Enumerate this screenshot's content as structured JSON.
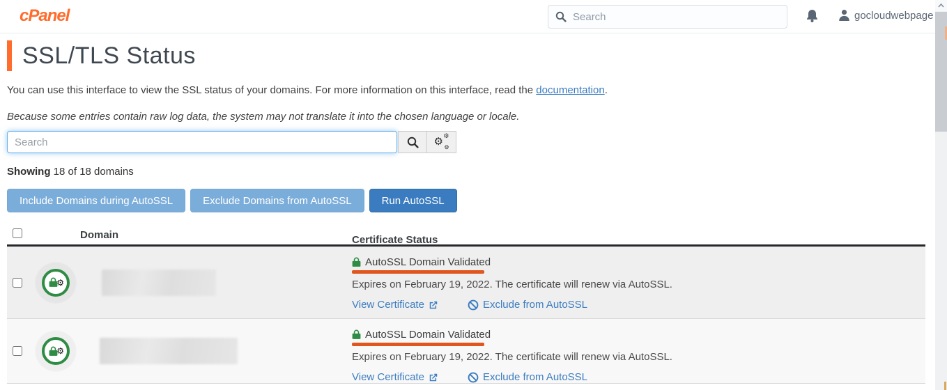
{
  "colors": {
    "brand-orange": "#ff6c2c",
    "link-blue": "#3a7cc0",
    "green": "#2f8c44",
    "annot-orange": "#e0561e",
    "btn-light": "#7badda",
    "btn-primary": "#3a7cbf"
  },
  "header": {
    "logo": "cPanel",
    "search_placeholder": "Search",
    "username": "gocloudwebpage"
  },
  "page": {
    "title": "SSL/TLS Status",
    "intro_before_link": "You can use this interface to view the SSL status of your domains. For more information on this interface, read the ",
    "intro_link": "documentation",
    "intro_after_link": ".",
    "locale_note": "Because some entries contain raw log data, the system may not translate it into the chosen language or locale.",
    "filter_placeholder": "Search",
    "showing_label": "Showing",
    "showing_rest": " 18 of 18 domains"
  },
  "actions": {
    "include_label": "Include Domains during AutoSSL",
    "exclude_label": "Exclude Domains from AutoSSL",
    "run_label": "Run AutoSSL"
  },
  "table": {
    "columns": [
      "Domain",
      "Certificate Status"
    ],
    "rows": [
      {
        "status": "AutoSSL Domain Validated",
        "expires": "Expires on February 19, 2022. The certificate will renew via AutoSSL.",
        "view_link": "View Certificate",
        "exclude_link": "Exclude from AutoSSL"
      },
      {
        "status": "AutoSSL Domain Validated",
        "expires": "Expires on February 19, 2022. The certificate will renew via AutoSSL.",
        "view_link": "View Certificate",
        "exclude_link": "Exclude from AutoSSL"
      }
    ]
  }
}
